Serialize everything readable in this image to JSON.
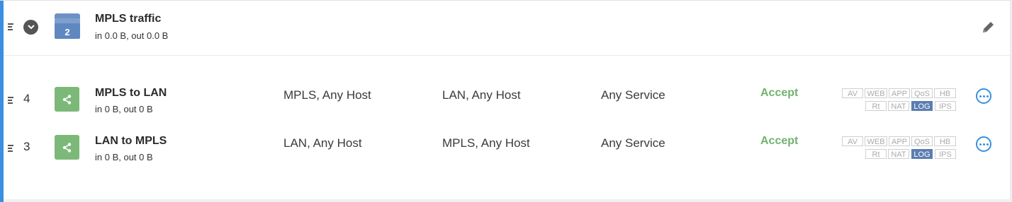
{
  "group": {
    "title": "MPLS traffic",
    "traffic": "in 0.0 B, out 0.0 B",
    "count": "2",
    "icons": {
      "expand": "chevron-down-icon",
      "group": "stacked-layers-icon",
      "edit": "pencil-icon"
    }
  },
  "rules": [
    {
      "number": "4",
      "name": "MPLS to LAN",
      "traffic": "in 0 B, out 0 B",
      "source": "MPLS, Any Host",
      "destination": "LAN, Any Host",
      "service": "Any Service",
      "action": "Accept",
      "badges_row1": [
        "AV",
        "WEB",
        "APP",
        "QoS",
        "HB"
      ],
      "badges_row2": [
        "Rt",
        "NAT",
        "LOG",
        "IPS"
      ],
      "active_badge": "LOG"
    },
    {
      "number": "3",
      "name": "LAN to MPLS",
      "traffic": "in 0 B, out 0 B",
      "source": "LAN, Any Host",
      "destination": "MPLS, Any Host",
      "service": "Any Service",
      "action": "Accept",
      "badges_row1": [
        "AV",
        "WEB",
        "APP",
        "QoS",
        "HB"
      ],
      "badges_row2": [
        "Rt",
        "NAT",
        "LOG",
        "IPS"
      ],
      "active_badge": "LOG"
    }
  ],
  "icons": {
    "rule": "share-icon",
    "more": "more-options-icon",
    "drag": "drag-handle-icon"
  },
  "colors": {
    "accent": "#3b8fe0",
    "accept": "#6fb36d",
    "rule_icon": "#7cb978",
    "group_icon": "#5f87c0",
    "active_badge": "#5b7db0"
  }
}
